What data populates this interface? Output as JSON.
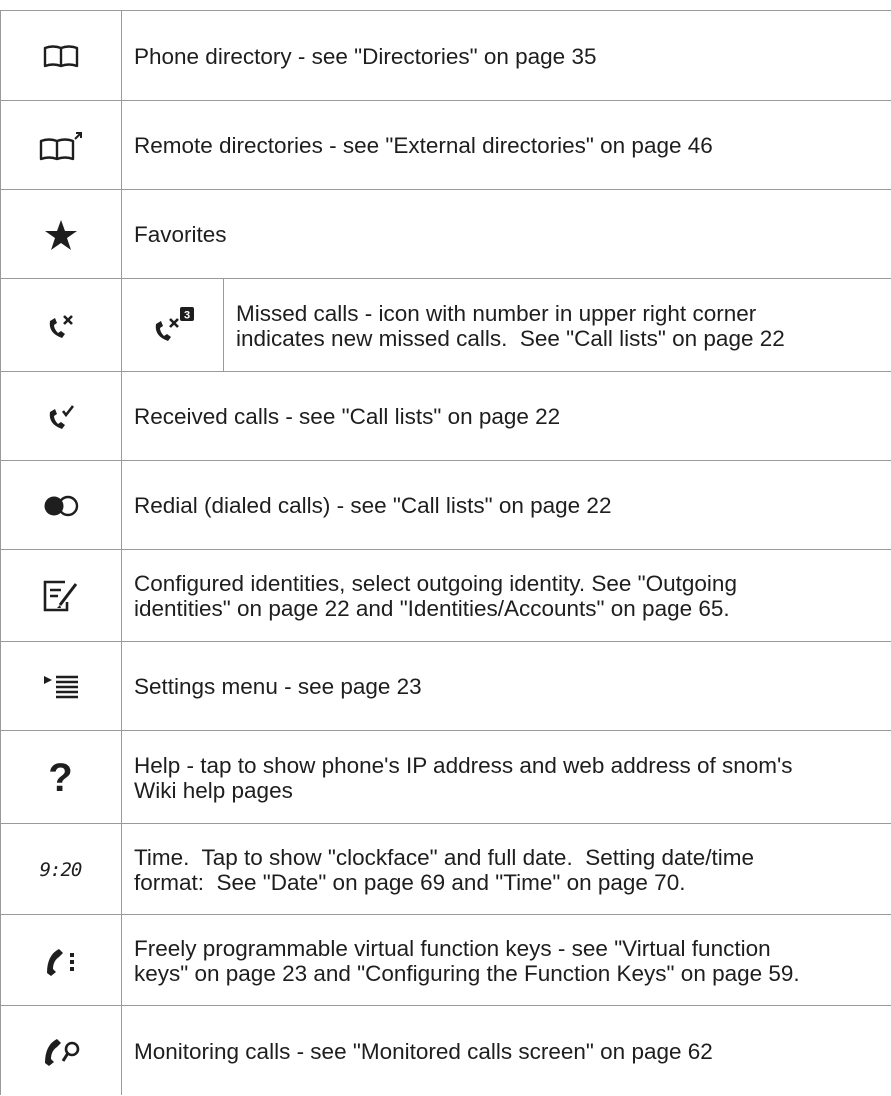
{
  "rows": [
    {
      "icon": "book-icon",
      "text": "Phone directory - see \"Directories\" on page 35"
    },
    {
      "icon": "book-remote-icon",
      "text": "Remote directories - see \"External directories\" on page 46"
    },
    {
      "icon": "star-icon",
      "text": "Favorites"
    },
    {
      "icon": "missed-call-icon",
      "sub_icon": "missed-call-badge-icon",
      "badge": "3",
      "text": "Missed calls - icon with number in upper right corner\nindicates new missed calls.  See \"Call lists\" on page 22"
    },
    {
      "icon": "received-call-icon",
      "text": "Received calls - see \"Call lists\" on page 22"
    },
    {
      "icon": "redial-icon",
      "text": "Redial (dialed calls) - see \"Call lists\" on page 22"
    },
    {
      "icon": "identity-icon",
      "text": "Configured identities, select outgoing identity. See \"Outgoing\nidentities\" on page 22 and \"Identities/Accounts\" on page 65."
    },
    {
      "icon": "settings-menu-icon",
      "text": "Settings menu - see page 23"
    },
    {
      "icon": "help-icon",
      "icon_text": "?",
      "text": "Help - tap to show phone's IP address and web address of snom's\nWiki help pages"
    },
    {
      "icon": "clock-icon",
      "icon_text": "9:20",
      "text": "Time.  Tap to show \"clockface\" and full date.  Setting date/time\nformat:  See \"Date\" on page 69 and \"Time\" on page 70."
    },
    {
      "icon": "function-keys-icon",
      "text": "Freely programmable virtual function keys - see \"Virtual function\nkeys\" on page 23 and \"Configuring the Function Keys\" on page 59."
    },
    {
      "icon": "monitoring-icon",
      "text": "Monitoring calls - see \"Monitored calls screen\" on page 62"
    }
  ]
}
